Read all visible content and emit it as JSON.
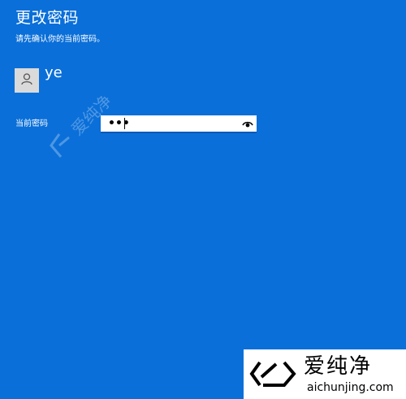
{
  "dialog": {
    "title": "更改密码",
    "subtitle": "请先确认你的当前密码。"
  },
  "account": {
    "username": "ye",
    "avatar_icon": "user-icon"
  },
  "password": {
    "label": "当前密码",
    "value_masked": "•••",
    "reveal_icon": "eye-icon"
  },
  "watermark": {
    "center_text": "爱纯净",
    "brand": "爱纯净",
    "url": "aichunjing.com"
  },
  "colors": {
    "background": "#0a6fd9",
    "text": "#ffffff",
    "field": "#ffffff"
  }
}
